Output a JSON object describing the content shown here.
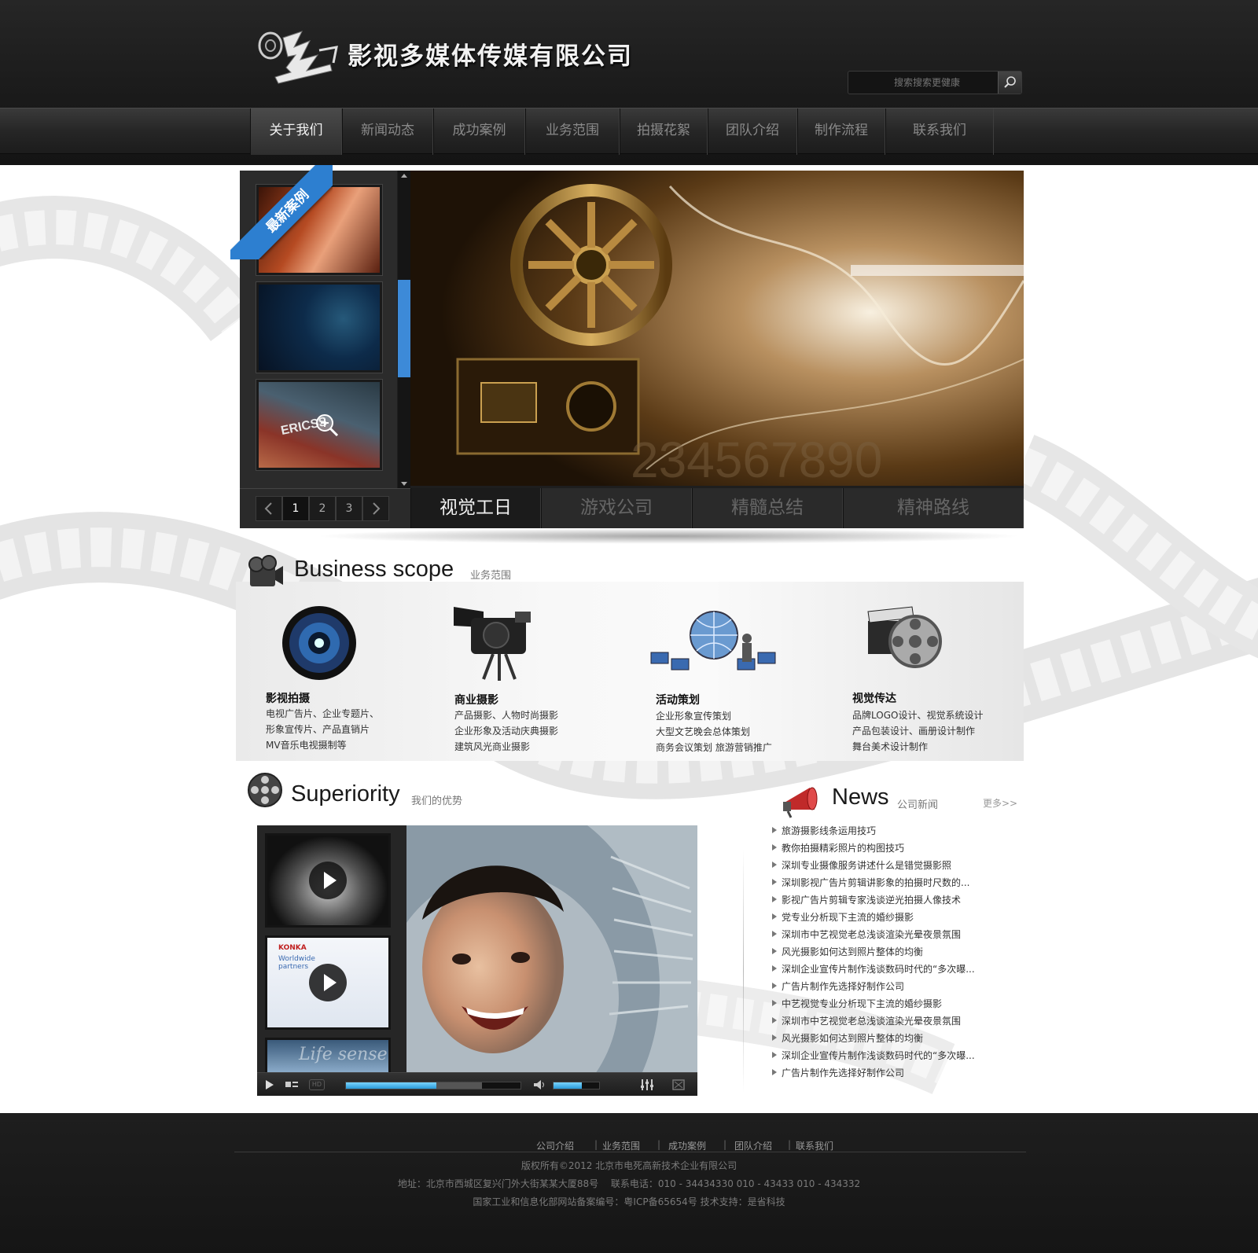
{
  "header": {
    "logo_text": "影视多媒体传媒有限公司",
    "search_placeholder": "搜索搜索更健康"
  },
  "nav": {
    "items": [
      "关于我们",
      "新闻动态",
      "成功案例",
      "业务范围",
      "拍摄花絮",
      "团队介绍",
      "制作流程",
      "联系我们"
    ],
    "active_index": 0
  },
  "banner": {
    "ribbon": "最新案例",
    "pager": [
      "1",
      "2",
      "3"
    ],
    "pager_active": 0,
    "tabs": [
      "视觉工日",
      "游戏公司",
      "精髓总结",
      "精神路线"
    ],
    "tab_active": 0,
    "main_overlay_digits": "234567890",
    "thumb_caption": "ERICSS"
  },
  "business": {
    "title": "Business scope",
    "subtitle": "业务范围",
    "services": [
      {
        "title": "影视拍摄",
        "lines": [
          "电视广告片、企业专题片、",
          "形象宣传片、产品直销片",
          "MV音乐电视摄制等"
        ],
        "icon": "camera-lens-icon"
      },
      {
        "title": "商业摄影",
        "lines": [
          "产品摄影、人物时尚摄影",
          "企业形象及活动庆典摄影",
          "建筑风光商业摄影"
        ],
        "icon": "video-camera-icon"
      },
      {
        "title": "活动策划",
        "lines": [
          "企业形象宣传策划",
          "大型文艺晚会总体策划",
          "商务会议策划 旅游营销推广"
        ],
        "icon": "network-globe-icon"
      },
      {
        "title": "视觉传达",
        "lines": [
          "品牌LOGO设计、视觉系统设计",
          "产品包装设计、画册设计制作",
          "舞台美术设计制作"
        ],
        "icon": "clapper-reel-icon"
      }
    ]
  },
  "superiority": {
    "title": "Superiority",
    "subtitle": "我们的优势",
    "video_thumb_texts": [
      "KONKA",
      "Worldwide partners",
      "Life sense"
    ],
    "progress": 0.52,
    "buffer": 0.78,
    "volume": 0.62,
    "hd_label": "HD"
  },
  "news": {
    "title": "News",
    "subtitle": "公司新闻",
    "more": "更多>>",
    "items": [
      "旅游摄影线条运用技巧",
      "教你拍摄精彩照片的构图技巧",
      "深圳专业摄像服务讲述什么是错觉摄影照",
      "深圳影视广告片剪辑讲影象的拍摄时尺数的...",
      "影视广告片剪辑专家浅谈逆光拍摄人像技术",
      "党专业分析现下主流的婚纱摄影",
      "深圳市中艺视觉老总浅谈渲染光晕夜景氛围",
      "风光摄影如何达到照片整体的均衡",
      "深圳企业宣传片制作浅谈数码时代的“多次曝...",
      "广告片制作先选择好制作公司",
      "中艺视觉专业分析现下主流的婚纱摄影",
      "深圳市中艺视觉老总浅谈渲染光晕夜景氛围",
      "风光摄影如何达到照片整体的均衡",
      "深圳企业宣传片制作浅谈数码时代的“多次曝...",
      "广告片制作先选择好制作公司"
    ]
  },
  "footer": {
    "links": [
      "公司介绍",
      "业务范围",
      "成功案例",
      "团队介绍",
      "联系我们"
    ],
    "separator": "|",
    "copyright": "版权所有©2012 北京市电死高新技术企业有限公司",
    "address": "地址：北京市西城区复兴门外大街某某大厦88号　 联系电话：010 - 34434330 010 - 43433 010 - 434332",
    "icp": "国家工业和信息化部网站备案编号：粤ICP备65654号 技术支持：是省科技"
  },
  "colors": {
    "header_bg": "#1c1c1c",
    "accent_blue": "#2d7fd0",
    "progress_blue": "#4ab8f0",
    "footer_bg": "#1a1a1a"
  }
}
